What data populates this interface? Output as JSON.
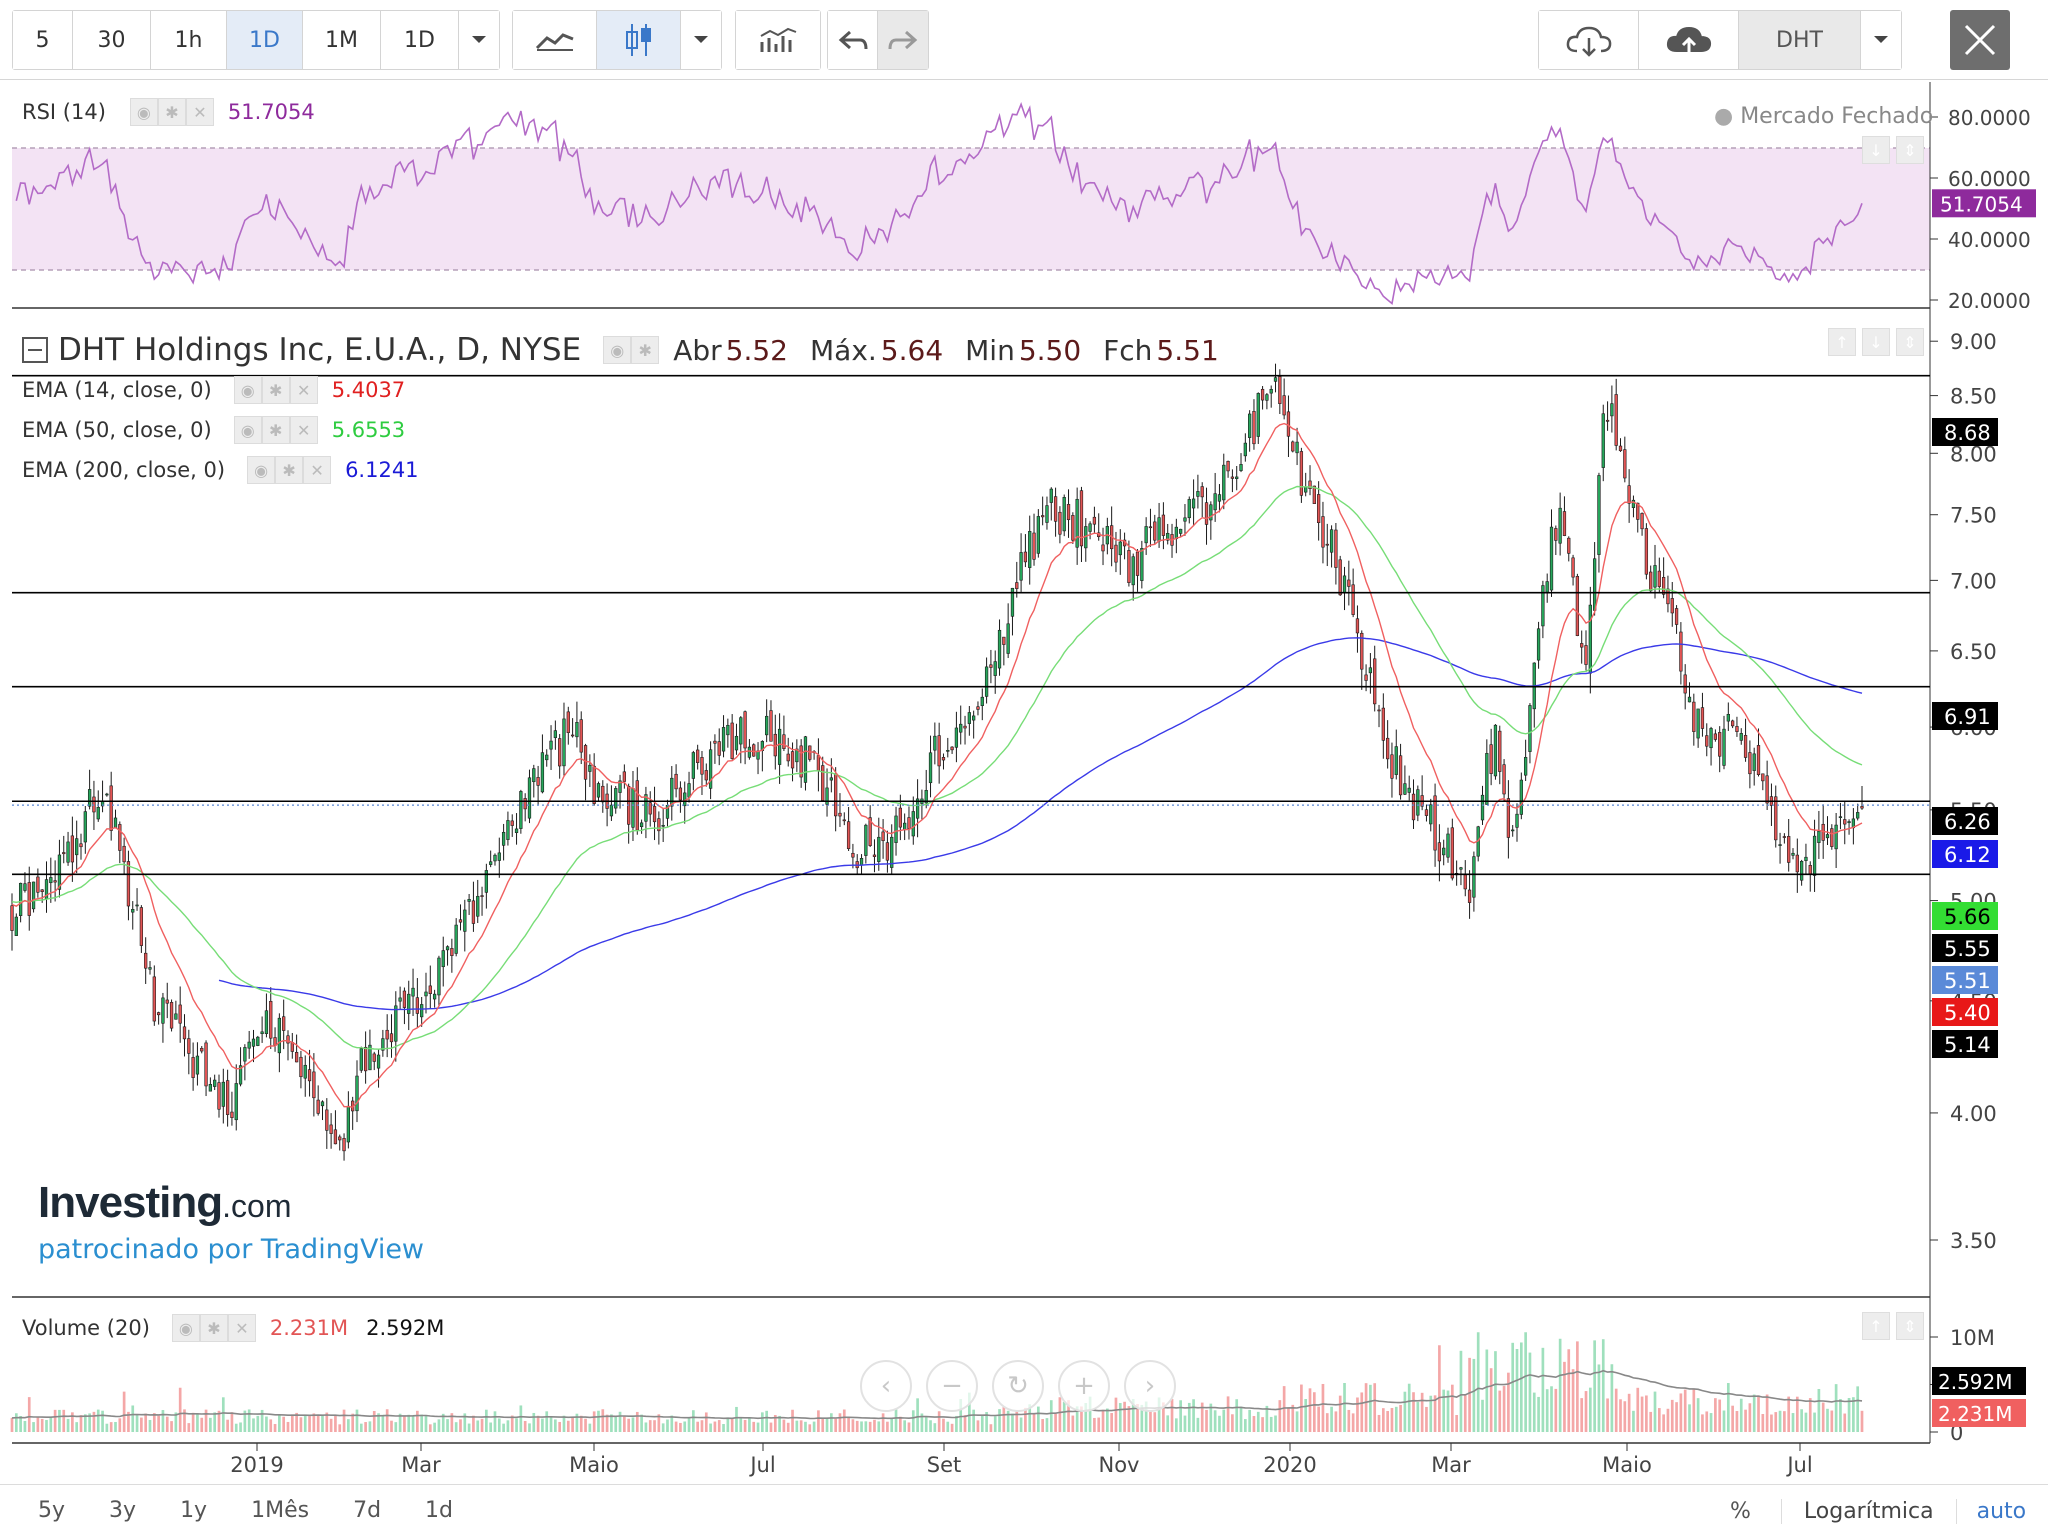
{
  "toolbar": {
    "intervals": [
      "5",
      "30",
      "1h",
      "1D",
      "1M",
      "1D"
    ],
    "active_interval": "1D",
    "symbol": "DHT"
  },
  "colors": {
    "up": "#26a65b",
    "down": "#e25555",
    "ema14": "#f06060",
    "ema50": "#77dd77",
    "ema200": "#3a3ae8",
    "rsi": "#b36bc7",
    "rsi_band": "#f3e3f4",
    "level_line": "#000000"
  },
  "rsi": {
    "label": "RSI (14)",
    "value": "51.7054",
    "market_status": "Mercado Fechado",
    "axis_labels": [
      "80.0000",
      "60.0000",
      "40.0000",
      "20.0000"
    ],
    "value_tag": "51.7054"
  },
  "main": {
    "title": "DHT Holdings Inc, E.U.A., D, NYSE",
    "open_label": "Abr",
    "open_value": "5.52",
    "high_label": "Máx.",
    "high_value": "5.64",
    "low_label": "Min",
    "low_value": "5.50",
    "close_label": "Fch",
    "close_value": "5.51",
    "ema14_label": "EMA (14, close, 0)",
    "ema14_value": "5.4037",
    "ema50_label": "EMA (50, close, 0)",
    "ema50_value": "5.6553",
    "ema200_label": "EMA (200, close, 0)",
    "ema200_value": "6.1241",
    "axis_labels": [
      "9.00",
      "8.50",
      "8.00",
      "7.50",
      "7.00",
      "6.50",
      "6.00",
      "5.50",
      "5.00",
      "4.50",
      "4.00",
      "3.50"
    ]
  },
  "volume": {
    "label": "Volume (20)",
    "value1": "2.231M",
    "value2": "2.592M",
    "axis_labels": [
      "10M",
      "5M",
      "0"
    ],
    "tag_black": "2.592M",
    "tag_red": "2.231M"
  },
  "xaxis": {
    "labels": [
      "2019",
      "Mar",
      "Maio",
      "Jul",
      "Set",
      "Nov",
      "2020",
      "Mar",
      "Maio",
      "Jul"
    ]
  },
  "bottom": {
    "ranges": [
      "5y",
      "3y",
      "1y",
      "1Mês",
      "7d",
      "1d"
    ],
    "percent": "%",
    "log": "Logarítmica",
    "auto": "auto"
  },
  "logo": {
    "brand": "Investing",
    "suffix": ".com",
    "sponsor": "patrocinado por TradingView"
  },
  "chart_data": {
    "type": "candlestick",
    "title": "DHT Holdings Inc, E.U.A., D, NYSE",
    "x_range": [
      "2018-11",
      "2020-07"
    ],
    "ylim": [
      3.3,
      9.3
    ],
    "y_scale": "log",
    "horizontal_levels": [
      8.68,
      6.91,
      6.26,
      5.55,
      5.14
    ],
    "price_tags": [
      {
        "value": "8.68",
        "kind": "level"
      },
      {
        "value": "6.91",
        "kind": "level"
      },
      {
        "value": "6.26",
        "kind": "level"
      },
      {
        "value": "6.12",
        "kind": "ema200"
      },
      {
        "value": "5.66",
        "kind": "ema50"
      },
      {
        "value": "5.55",
        "kind": "level"
      },
      {
        "value": "5.51",
        "kind": "last"
      },
      {
        "value": "5.40",
        "kind": "ema14"
      },
      {
        "value": "5.14",
        "kind": "level"
      }
    ],
    "close_anchors": [
      [
        "2018-11-01",
        4.95
      ],
      [
        "2018-11-15",
        5.05
      ],
      [
        "2018-12-01",
        5.62
      ],
      [
        "2018-12-10",
        5.1
      ],
      [
        "2018-12-20",
        4.45
      ],
      [
        "2019-01-01",
        4.25
      ],
      [
        "2019-01-15",
        4.0
      ],
      [
        "2019-01-25",
        4.45
      ],
      [
        "2019-02-10",
        4.15
      ],
      [
        "2019-02-20",
        3.85
      ],
      [
        "2019-03-01",
        4.25
      ],
      [
        "2019-03-15",
        4.45
      ],
      [
        "2019-04-01",
        4.8
      ],
      [
        "2019-04-15",
        5.25
      ],
      [
        "2019-05-01",
        5.75
      ],
      [
        "2019-05-10",
        6.0
      ],
      [
        "2019-05-20",
        5.55
      ],
      [
        "2019-06-10",
        5.5
      ],
      [
        "2019-06-25",
        5.8
      ],
      [
        "2019-07-10",
        5.95
      ],
      [
        "2019-07-20",
        5.95
      ],
      [
        "2019-08-01",
        5.75
      ],
      [
        "2019-08-15",
        5.3
      ],
      [
        "2019-08-25",
        5.25
      ],
      [
        "2019-09-05",
        5.65
      ],
      [
        "2019-09-20",
        6.1
      ],
      [
        "2019-10-01",
        6.4
      ],
      [
        "2019-10-10",
        7.1
      ],
      [
        "2019-10-20",
        7.55
      ],
      [
        "2019-11-01",
        7.4
      ],
      [
        "2019-11-15",
        7.1
      ],
      [
        "2019-12-01",
        7.45
      ],
      [
        "2019-12-15",
        7.6
      ],
      [
        "2019-12-28",
        8.3
      ],
      [
        "2020-01-03",
        8.6
      ],
      [
        "2020-01-10",
        8.0
      ],
      [
        "2020-01-20",
        7.4
      ],
      [
        "2020-02-01",
        6.6
      ],
      [
        "2020-02-10",
        5.9
      ],
      [
        "2020-02-20",
        5.55
      ],
      [
        "2020-03-01",
        5.3
      ],
      [
        "2020-03-10",
        5.1
      ],
      [
        "2020-03-18",
        5.95
      ],
      [
        "2020-03-25",
        5.2
      ],
      [
        "2020-04-01",
        6.5
      ],
      [
        "2020-04-10",
        7.7
      ],
      [
        "2020-04-18",
        6.2
      ],
      [
        "2020-04-25",
        8.5
      ],
      [
        "2020-05-01",
        7.9
      ],
      [
        "2020-05-08",
        7.2
      ],
      [
        "2020-05-18",
        6.6
      ],
      [
        "2020-05-28",
        5.9
      ],
      [
        "2020-06-08",
        6.0
      ],
      [
        "2020-06-20",
        5.5
      ],
      [
        "2020-06-28",
        5.2
      ],
      [
        "2020-07-10",
        5.35
      ],
      [
        "2020-07-21",
        5.51
      ]
    ]
  }
}
